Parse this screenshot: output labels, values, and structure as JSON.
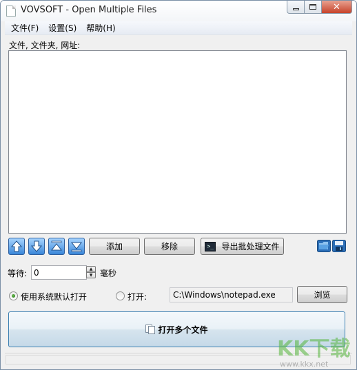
{
  "window": {
    "title": "VOVSOFT - Open Multiple Files",
    "minimize_glyph": "",
    "maximize_glyph": "",
    "close_glyph": "✕"
  },
  "menu": {
    "file": "文件(F)",
    "settings": "设置(S)",
    "help": "帮助(H)"
  },
  "files": {
    "label": "文件, 文件夹, 网址:"
  },
  "toolbar": {
    "add": "添加",
    "remove": "移除",
    "export_batch": "导出批处理文件",
    "icons": [
      "arrow-up-icon",
      "arrow-down-icon",
      "arrow-top-icon",
      "arrow-bottom-icon",
      "folder-open-icon",
      "save-disk-icon"
    ]
  },
  "wait": {
    "label": "等待:",
    "value": "0",
    "unit": "毫秒"
  },
  "open_mode": {
    "default_label": "使用系统默认打开",
    "custom_label": "打开:",
    "selected": "default",
    "path": "C:\\Windows\\notepad.exe",
    "browse": "浏览"
  },
  "main_action": {
    "label": "打开多个文件"
  },
  "watermark": {
    "brand": "KK下载",
    "url": "www.kkx.net"
  },
  "colors": {
    "accent_blue": "#3a86d8",
    "close_red": "#c7432a",
    "watermark_green": "#53b53a"
  }
}
